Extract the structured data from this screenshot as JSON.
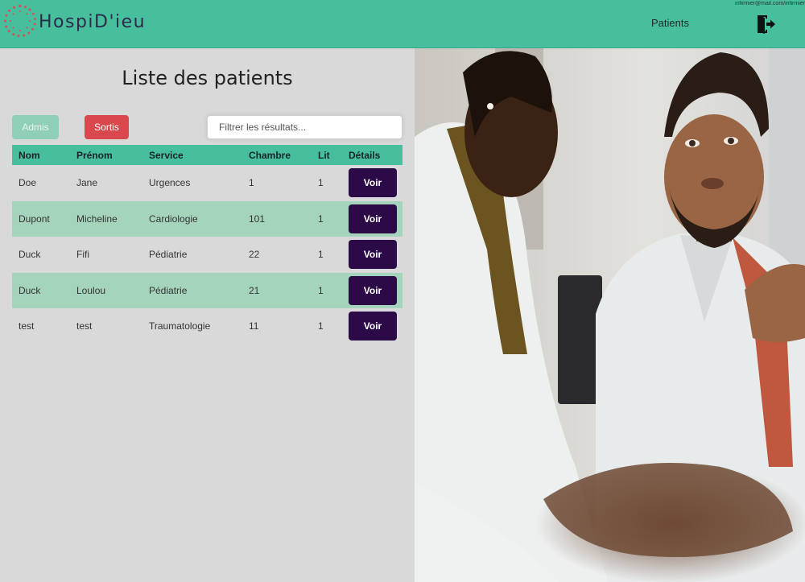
{
  "brand": {
    "name": "HospiD'ieu"
  },
  "header": {
    "user": "infirmier@mail.com/infirmier",
    "nav_patients": "Patients",
    "logout_icon": "logout-door-icon"
  },
  "page": {
    "title": "Liste des patients",
    "filter_admis": "Admis",
    "filter_sortis": "Sortis",
    "search_placeholder": "Filtrer les résultats..."
  },
  "table": {
    "headers": [
      "Nom",
      "Prénom",
      "Service",
      "Chambre",
      "Lit",
      "Détails"
    ],
    "rows": [
      {
        "nom": "Doe",
        "prenom": "Jane",
        "service": "Urgences",
        "chambre": "1",
        "lit": "1",
        "action": "Voir"
      },
      {
        "nom": "Dupont",
        "prenom": "Micheline",
        "service": "Cardiologie",
        "chambre": "101",
        "lit": "1",
        "action": "Voir"
      },
      {
        "nom": "Duck",
        "prenom": "Fifi",
        "service": "Pédiatrie",
        "chambre": "22",
        "lit": "1",
        "action": "Voir"
      },
      {
        "nom": "Duck",
        "prenom": "Loulou",
        "service": "Pédiatrie",
        "chambre": "21",
        "lit": "1",
        "action": "Voir"
      },
      {
        "nom": "test",
        "prenom": "test",
        "service": "Traumatologie",
        "chambre": "11",
        "lit": "1",
        "action": "Voir"
      }
    ]
  },
  "colors": {
    "navbar": "#47bf9c",
    "row_alt": "#a5d4bd",
    "voir_button": "#2c0a47",
    "sortis_button": "#d9484c",
    "admis_button": "#8fceb7",
    "logo_dots": "#d94e5c"
  }
}
